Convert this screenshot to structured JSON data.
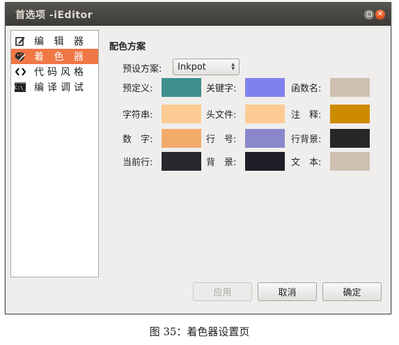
{
  "window": {
    "title": "首选项 -iEditor"
  },
  "sidebar": {
    "items": [
      {
        "label": "编 辑 器",
        "icon": "edit-icon",
        "active": false
      },
      {
        "label": "着 色 器",
        "icon": "palette-icon",
        "active": true
      },
      {
        "label": "代码风格",
        "icon": "code-brackets-icon",
        "active": false
      },
      {
        "label": "编译调试",
        "icon": "terminal-icon",
        "active": false
      }
    ]
  },
  "terminal_icon_text": "C:\\_",
  "scheme": {
    "section_title": "配色方案",
    "preset_label": "预设方案:",
    "preset_value": "Inkpot",
    "colors": [
      {
        "label": "预定义:",
        "color": "#3e908e"
      },
      {
        "label": "关键字:",
        "color": "#7f82ec"
      },
      {
        "label": "函数名:",
        "color": "#cfc1b0"
      },
      {
        "label": "字符串:",
        "color": "#fdcb94"
      },
      {
        "label": "头文件:",
        "color": "#fdcb94"
      },
      {
        "label": "注　释:",
        "color": "#cd8b00"
      },
      {
        "label": "数　字:",
        "color": "#f3ab6c"
      },
      {
        "label": "行　号:",
        "color": "#8a88cb"
      },
      {
        "label": "行背景:",
        "color": "#272727"
      },
      {
        "label": "当前行:",
        "color": "#29282e"
      },
      {
        "label": "背　景:",
        "color": "#1e1e27"
      },
      {
        "label": "文　本:",
        "color": "#cfc1b0"
      }
    ]
  },
  "buttons": {
    "apply": "应用",
    "cancel": "取消",
    "ok": "确定"
  },
  "caption": "图 35：着色器设置页"
}
